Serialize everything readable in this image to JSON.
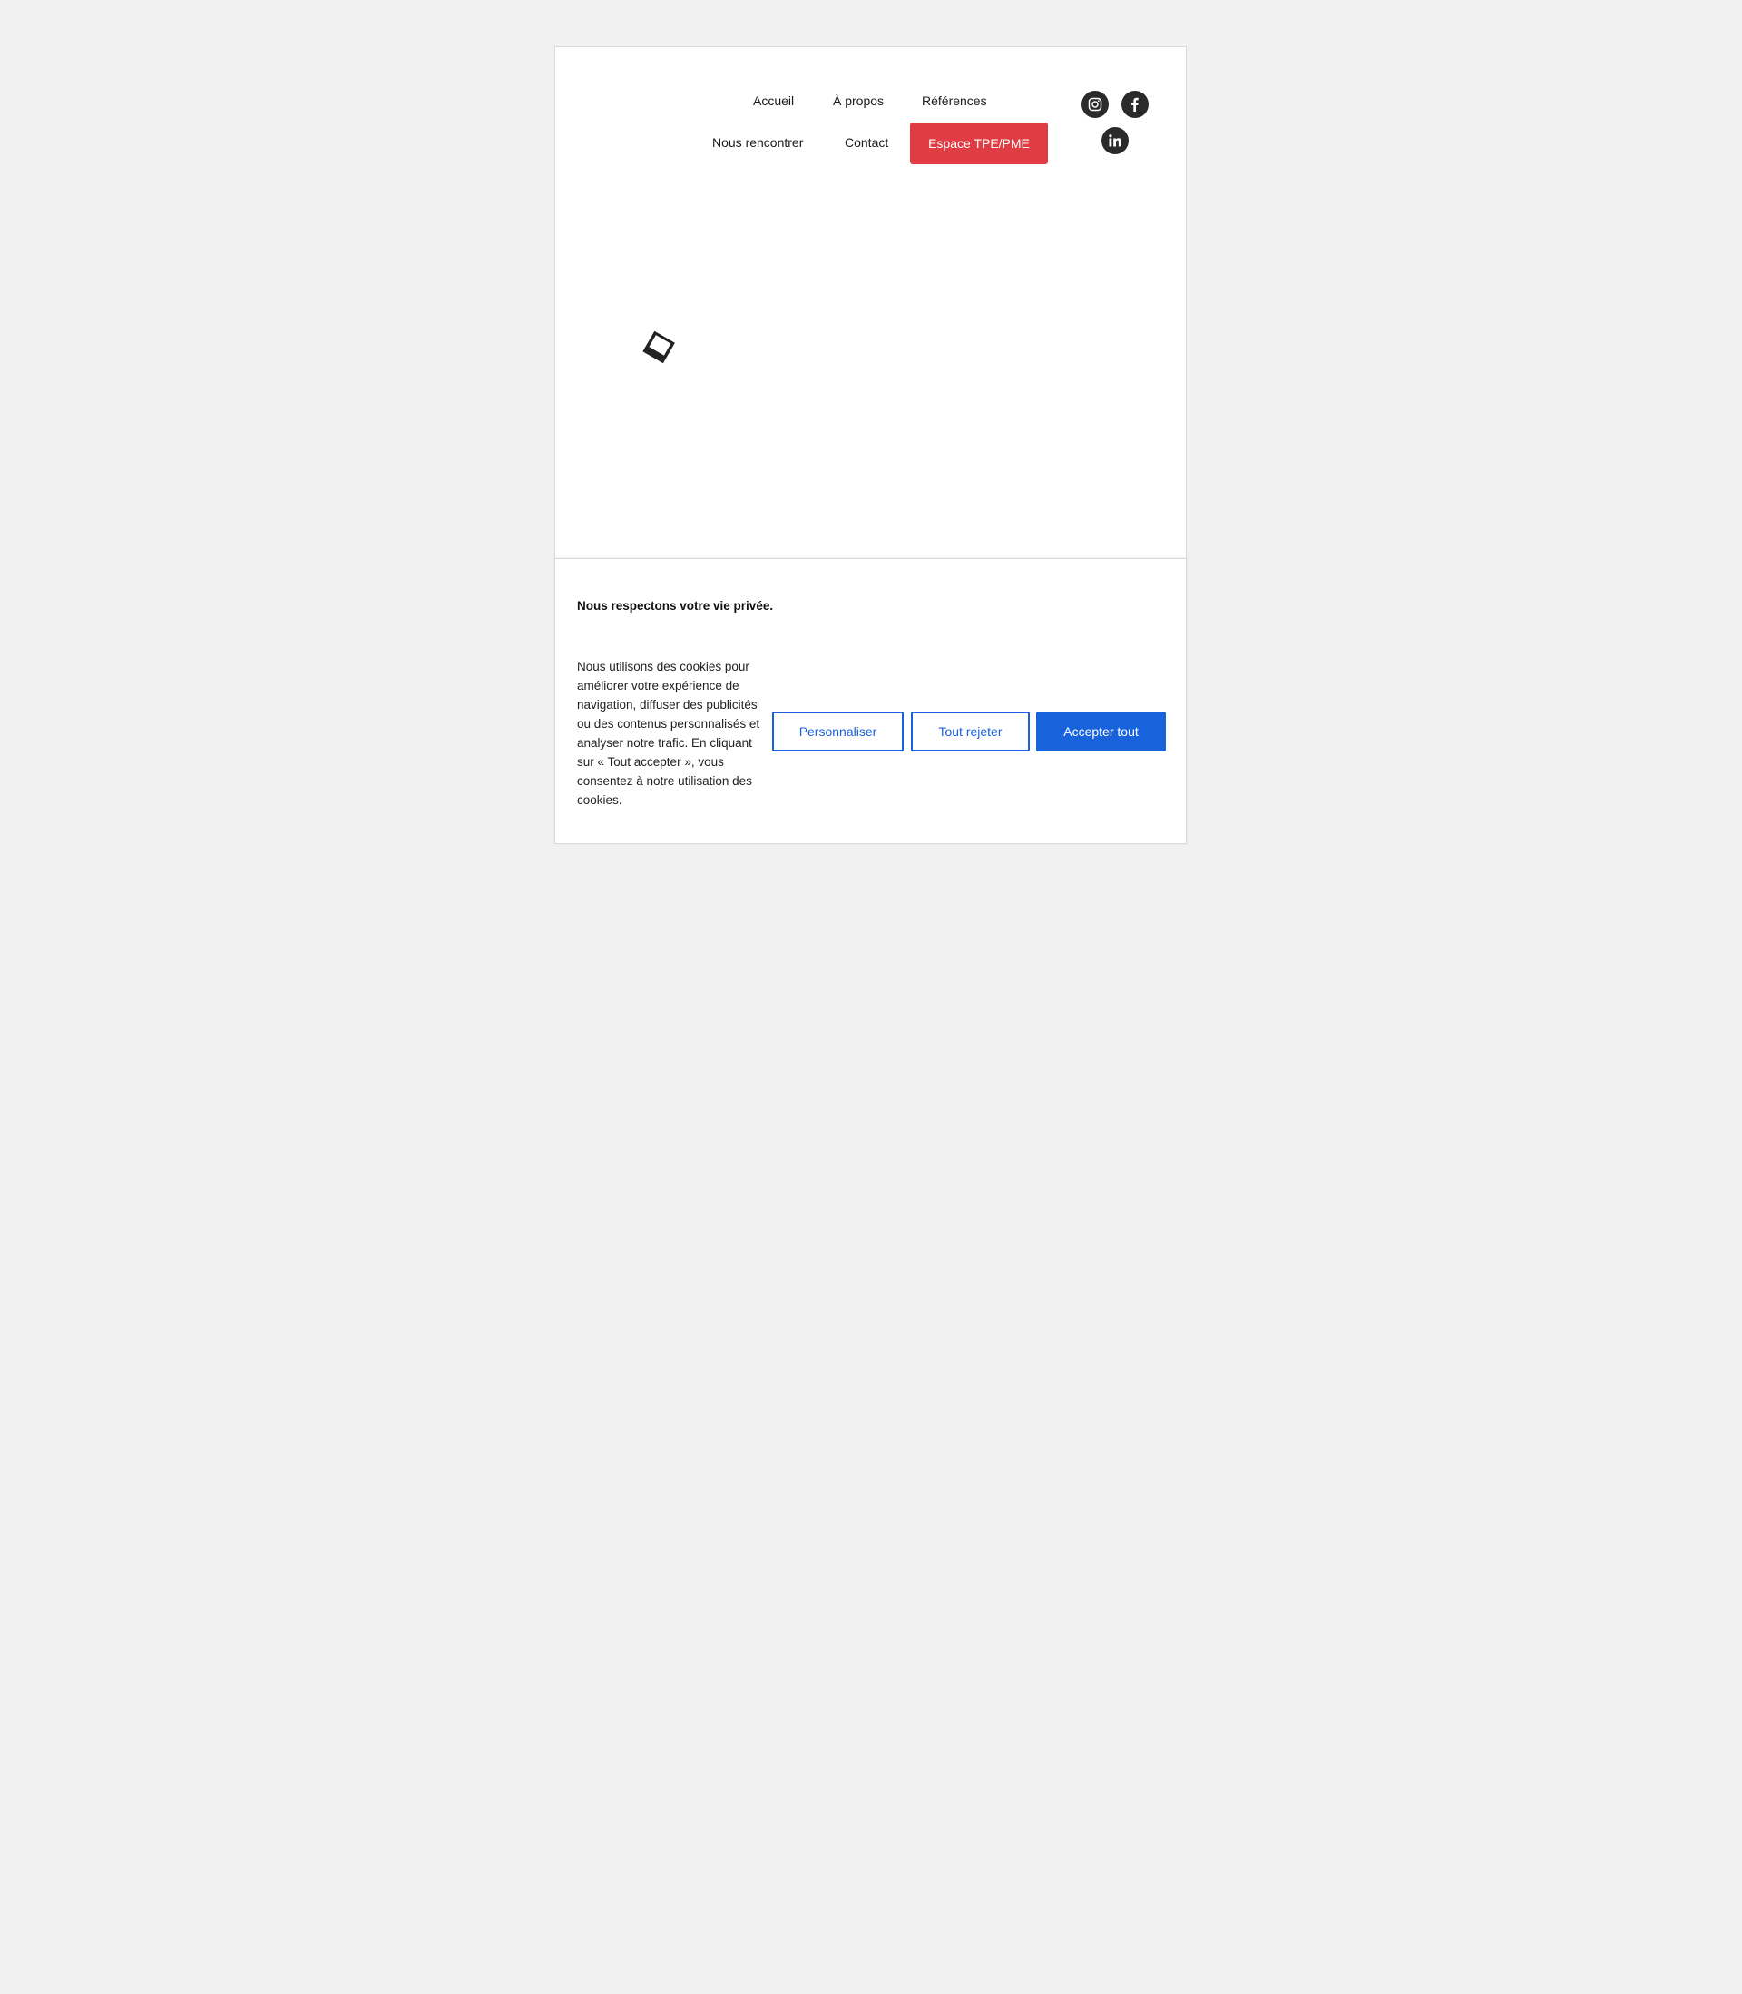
{
  "nav": {
    "items": [
      {
        "label": "Accueil"
      },
      {
        "label": "À propos"
      },
      {
        "label": "Références"
      },
      {
        "label": "Nous rencontrer"
      },
      {
        "label": "Contact"
      }
    ],
    "cta_label": "Espace TPE/PME"
  },
  "social": [
    {
      "icon": "instagram-icon"
    },
    {
      "icon": "facebook-icon"
    },
    {
      "icon": "linkedin-icon"
    }
  ],
  "colors": {
    "accent_red": "#e13b43",
    "accent_blue": "#1863dc",
    "background": "#f1f1f1",
    "social_icon_bg": "#2b2b2b"
  },
  "cookie": {
    "title": "Nous respectons votre vie privée.",
    "text": "Nous utilisons des cookies pour améliorer votre expérience de navigation, diffuser des publicités ou des contenus personnalisés et analyser notre trafic. En cliquant sur « Tout accepter », vous consentez à notre utilisation des cookies.",
    "customize_label": "Personnaliser",
    "reject_label": "Tout rejeter",
    "accept_label": "Accepter tout"
  }
}
